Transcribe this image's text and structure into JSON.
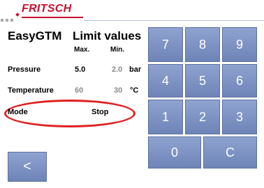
{
  "header": {
    "logo_text": "FRITSCH"
  },
  "app_title": "EasyGTM",
  "section_title": "Limit values",
  "columns": {
    "max": "Max.",
    "min": "Min."
  },
  "rows": {
    "pressure": {
      "label": "Pressure",
      "max": "5.0",
      "min": "2.0",
      "unit": "bar"
    },
    "temperature": {
      "label": "Temperature",
      "max": "60",
      "min": "30",
      "unit": "°C"
    },
    "mode": {
      "label": "Mode",
      "value": "Stop"
    }
  },
  "keypad": {
    "k7": "7",
    "k8": "8",
    "k9": "9",
    "k4": "4",
    "k5": "5",
    "k6": "6",
    "k1": "1",
    "k2": "2",
    "k3": "3",
    "k0": "0",
    "clear": "C"
  },
  "back_label": "<",
  "colors": {
    "accent": "#7c90c2",
    "logo": "#c8102e",
    "highlight": "#e02020"
  }
}
